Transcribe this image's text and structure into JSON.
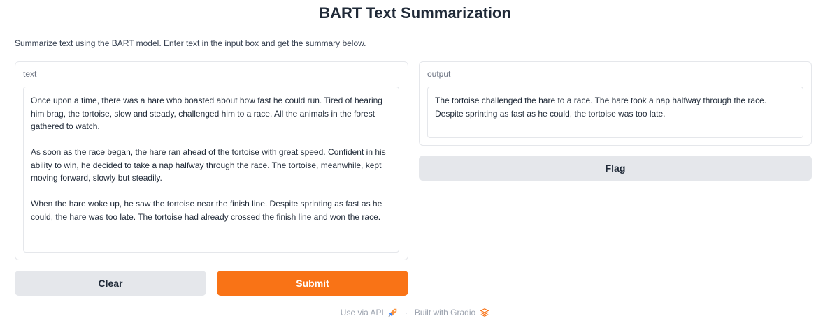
{
  "app": {
    "title": "BART Text Summarization",
    "description": "Summarize text using the BART model. Enter text in the input box and get the summary below."
  },
  "input_panel": {
    "label": "text",
    "value": "Once upon a time, there was a hare who boasted about how fast he could run. Tired of hearing\nhim brag, the tortoise, slow and steady, challenged him to a race. All the animals in the forest\ngathered to watch.\n\nAs soon as the race began, the hare ran ahead of the tortoise with great speed. Confident in his\nability to win, he decided to take a nap halfway through the race. The tortoise, meanwhile, kept\nmoving forward, slowly but steadily.\n\nWhen the hare woke up, he saw the tortoise near the finish line. Despite sprinting as fast as he\ncould, the hare was too late. The tortoise had already crossed the finish line and won the race."
  },
  "output_panel": {
    "label": "output",
    "value": "The tortoise challenged the hare to a race. The hare took a nap halfway through the race.\nDespite sprinting as fast as he could, the tortoise was too late."
  },
  "buttons": {
    "clear_label": "Clear",
    "submit_label": "Submit",
    "flag_label": "Flag"
  },
  "footer": {
    "api_label": "Use via API",
    "separator": "·",
    "built_label": "Built with Gradio",
    "api_icon": "rocket-icon",
    "gradio_icon": "gradio-logo-icon"
  },
  "colors": {
    "primary": "#f97316",
    "secondary": "#e5e7eb"
  }
}
